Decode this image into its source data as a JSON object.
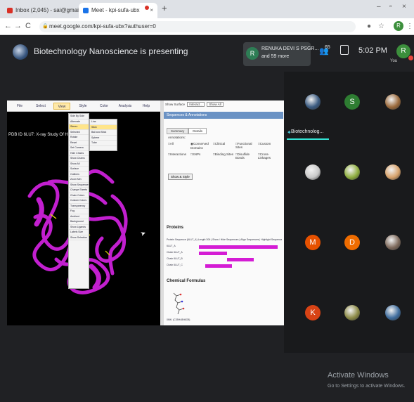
{
  "browser": {
    "tabs": [
      {
        "title": "Inbox (2,045) - sai@gmail.com",
        "favicon_color": "#d93025"
      },
      {
        "title": "Meet - kpi-sufa-ubx",
        "favicon_color": "#1a73e8"
      }
    ],
    "new_tab": "+",
    "window_controls": [
      "–",
      "▫",
      "×"
    ],
    "nav": {
      "back": "←",
      "forward": "→",
      "reload": "C"
    },
    "url": "meet.google.com/kpi-sufa-ubx?authuser=0",
    "profile_initial": "R"
  },
  "meet": {
    "presenting_text": "Biotechnology Nanoscience is presenting",
    "now_presenting": {
      "initial": "R",
      "line1": "RENUKA DEVI S PSGR...",
      "line2": "and 59 more"
    },
    "people_count": "65",
    "time": "5:02 PM",
    "you": {
      "initial": "R",
      "label": "You"
    }
  },
  "shared_screen": {
    "nav_tabs": [
      "File",
      "Select",
      "View",
      "Style",
      "Color",
      "Analysis",
      "Help"
    ],
    "active_nav": 2,
    "pdb_title": "PDB ID 6LU7: X-ray Study Of Hu...",
    "menu_items": [
      "Side By Side",
      "Alternate",
      "Stereo",
      "Selected",
      "Rotate",
      "Reset",
      "Set Camera",
      "Hide Chains",
      "Show Chains",
      "Show All",
      "Surface",
      "Outlines",
      "Zoom Min",
      "Show Sequences",
      "Change Sheets",
      "Chain Colors",
      "Custom Colors",
      "Transparency",
      "Fog",
      "Ambient",
      "Background",
      "Show Ligands",
      "Labels Size",
      "Show Selection"
    ],
    "highlight_menu_index": 2,
    "submenu_items": [
      "Line",
      "Stick",
      "Ball and Stick",
      "Sphere",
      "Tube"
    ],
    "side_top": {
      "label": "Show Surface",
      "value1": "Interact...",
      "value2": "Show All"
    },
    "panel_title": "Sequences & Annotations",
    "panel_tabs": [
      "Summary",
      "Details"
    ],
    "annotations_label": "Annotations:",
    "options": [
      "All",
      "Conserved Domains",
      "Clinical",
      "Functional Sites",
      "Custom",
      "Interactions",
      "SNPs",
      "Binding Sites",
      "Disulfide Bonds",
      "Cross-Linkages"
    ],
    "options_on": [
      1
    ],
    "style_button": "Show & Style",
    "proteins_title": "Proteins",
    "seq_header": "Protein Sequence (6LU7_A) Length 306 | Show / Hide Sequences | Align Sequences | Highlight Sequence",
    "features": [
      {
        "label": "6LU7_A",
        "start": 0,
        "end": 100
      },
      {
        "label": "Chain 6LU7_A",
        "start": 0,
        "end": 36
      },
      {
        "label": "Chain 6LU7_B",
        "start": 36,
        "end": 70
      },
      {
        "label": "Chain 6LU7_C",
        "start": 8,
        "end": 42
      }
    ],
    "chem_title": "Chemical Formulas",
    "chem_caption": "0MK: (C35H48N6O8)"
  },
  "participants": [
    {
      "initial": "",
      "color": "#3a5a80",
      "kind": "photo"
    },
    {
      "initial": "S",
      "color": "#2e7d32",
      "kind": "initial"
    },
    {
      "initial": "",
      "color": "#9b6a3c",
      "kind": "photo"
    },
    {
      "initial": "",
      "color": "#c9c9c9",
      "kind": "photo"
    },
    {
      "initial": "",
      "color": "#8fae3f",
      "kind": "photo"
    },
    {
      "initial": "",
      "color": "#d7a26b",
      "kind": "photo"
    },
    {
      "initial": "M",
      "color": "#e65100",
      "kind": "initial"
    },
    {
      "initial": "D",
      "color": "#ef6c00",
      "kind": "initial"
    },
    {
      "initial": "",
      "color": "#7e6a5c",
      "kind": "photo"
    },
    {
      "initial": "K",
      "color": "#d84315",
      "kind": "initial"
    },
    {
      "initial": "",
      "color": "#8d8b47",
      "kind": "photo"
    },
    {
      "initial": "",
      "color": "#3f6d9e",
      "kind": "photo"
    }
  ],
  "presenter_tile_name": "Biotechnolog...",
  "windows_activation": {
    "line1": "Activate Windows",
    "line2": "Go to Settings to activate Windows."
  }
}
